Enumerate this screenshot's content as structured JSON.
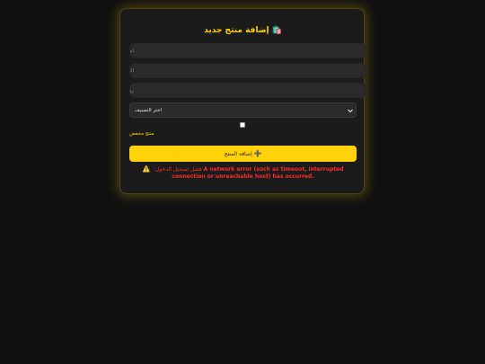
{
  "form": {
    "title": "إضافة منتج جديد",
    "title_icon": "shopping-bags-icon",
    "name_placeholder": "اسم المنتج",
    "price_placeholder": "السعر",
    "images_placeholder": "روابط الصور (افصل بينها بفاصلة ,)",
    "category_selected": "اختر التصنيف",
    "discount_label": "منتج مخفض",
    "discount_checked": false,
    "submit_label": "إضافة المنتج",
    "submit_icon": "plus-icon"
  },
  "error": {
    "icon": "warning-icon",
    "prefix": "فشل تسجيل الدخول:",
    "message": "A network error (such as timeout, interrupted connection or unreachable host) has occurred."
  },
  "colors": {
    "accent": "#ffd400",
    "error": "#ff2b2b",
    "background": "#111111",
    "card": "#1b1b1b"
  }
}
